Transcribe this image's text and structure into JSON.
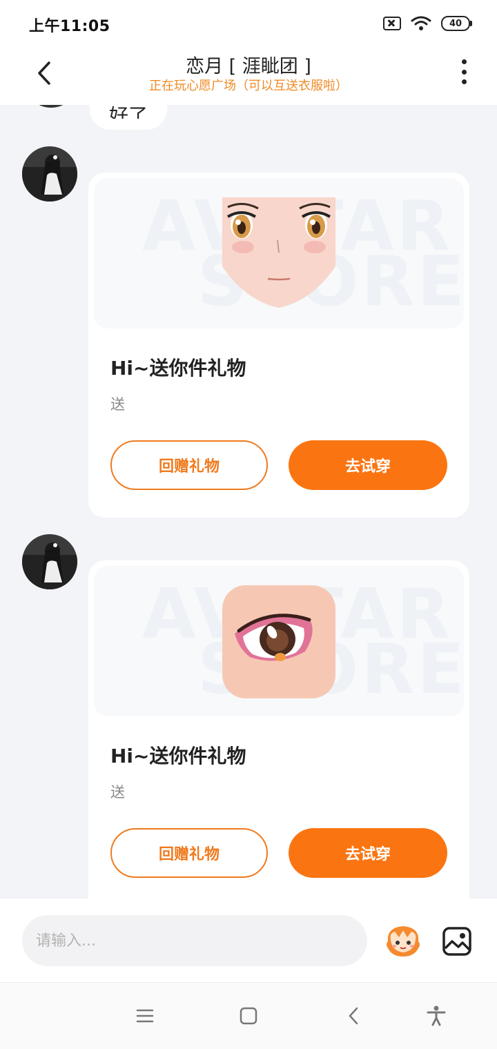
{
  "status_bar": {
    "time": "上午11:05",
    "battery": "40"
  },
  "header": {
    "title": "恋月 [ 涯眦团 ]",
    "subtitle": "正在玩心愿广场（可以互送衣服啦）"
  },
  "previous_message": {
    "text": "好了"
  },
  "messages": [
    {
      "watermark": [
        "AVATAR",
        "STORE"
      ],
      "title": "Hi~送你件礼物",
      "subtitle": "送",
      "secondary_button": "回赠礼物",
      "primary_button": "去试穿",
      "item_icon": "face-item-icon"
    },
    {
      "watermark": [
        "AVATAR",
        "STORE"
      ],
      "title": "Hi~送你件礼物",
      "subtitle": "送",
      "secondary_button": "回赠礼物",
      "primary_button": "去试穿",
      "item_icon": "eye-item-icon"
    }
  ],
  "input": {
    "placeholder": "请输入..."
  },
  "colors": {
    "accent": "#fa7512",
    "subtitle": "#f08a24",
    "background": "#f2f4f7"
  }
}
